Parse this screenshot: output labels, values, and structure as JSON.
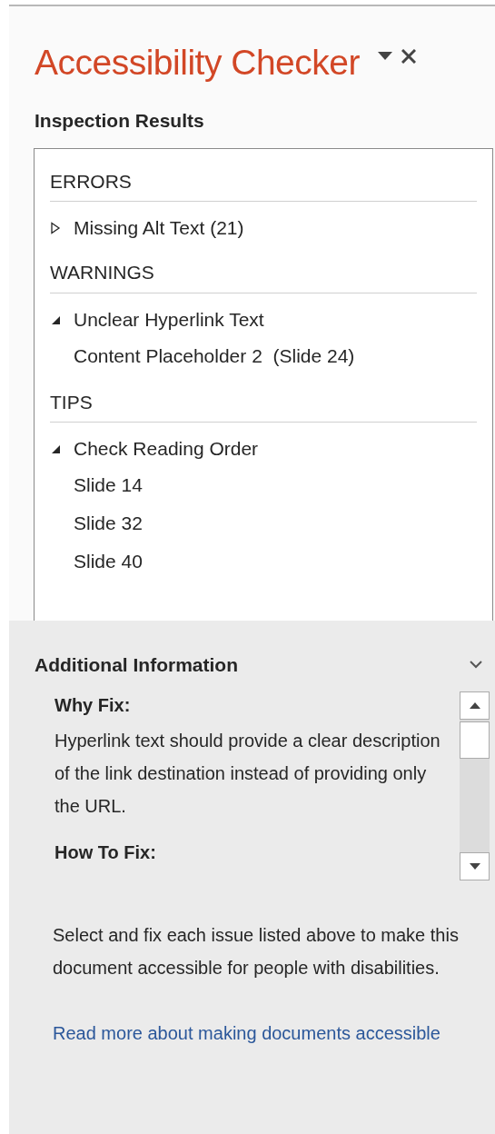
{
  "title": "Accessibility Checker",
  "inspection_results": {
    "heading": "Inspection Results",
    "sections": [
      {
        "heading": "ERRORS",
        "groups": [
          {
            "label": "Missing Alt Text (21)",
            "expanded": false
          }
        ]
      },
      {
        "heading": "WARNINGS",
        "groups": [
          {
            "label": "Unclear Hyperlink Text",
            "expanded": true,
            "children": [
              {
                "label": "Content Placeholder 2  (Slide 24)"
              }
            ]
          }
        ]
      },
      {
        "heading": "TIPS",
        "groups": [
          {
            "label": "Check Reading Order",
            "expanded": true,
            "children": [
              {
                "label": "Slide 14"
              },
              {
                "label": "Slide 32"
              },
              {
                "label": "Slide 40"
              }
            ]
          }
        ]
      }
    ]
  },
  "additional_information": {
    "heading": "Additional Information",
    "why_fix_heading": "Why Fix:",
    "why_fix_text": "Hyperlink text should provide a clear description of the link destination instead of providing only the URL.",
    "how_to_fix_heading": "How To Fix:"
  },
  "footer": {
    "text": "Select and fix each issue listed above to make this document accessible for people with disabilities.",
    "link": "Read more about making documents accessible"
  }
}
